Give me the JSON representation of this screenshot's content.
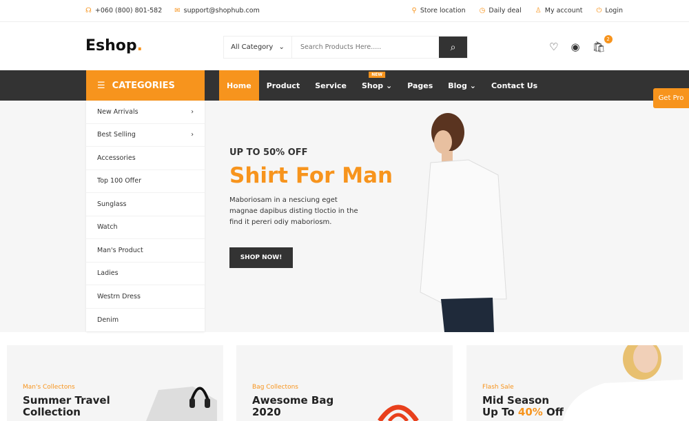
{
  "topbar": {
    "phone": "+060 (800) 801-582",
    "email": "support@shophub.com",
    "store": "Store location",
    "deal": "Daily deal",
    "account": "My account",
    "login": "Login"
  },
  "header": {
    "logo": "Eshop",
    "logo_dot": ".",
    "category": "All Category",
    "search_placeholder": "Search Products Here.....",
    "cart_count": "2"
  },
  "nav": {
    "categories": "CATEGORIES",
    "items": [
      "Home",
      "Product",
      "Service",
      "Shop",
      "Pages",
      "Blog",
      "Contact Us"
    ],
    "new_badge": "NEW",
    "get_pro": "Get Pro"
  },
  "categories": [
    "New Arrivals",
    "Best Selling",
    "Accessories",
    "Top 100 Offer",
    "Sunglass",
    "Watch",
    "Man's Product",
    "Ladies",
    "Westrn Dress",
    "Denim"
  ],
  "hero": {
    "kicker": "UP TO 50% OFF",
    "title": "Shirt For Man",
    "desc": "Maboriosam in a nesciung eget magnae dapibus disting tloctio in the find it pereri odiy maboriosm.",
    "button": "SHOP NOW!"
  },
  "cards": [
    {
      "sub": "Man's Collectons",
      "title1": "Summer Travel",
      "title2": "Collection"
    },
    {
      "sub": "Bag Collectons",
      "title1": "Awesome Bag",
      "title2": "2020"
    },
    {
      "sub": "Flash Sale",
      "title1": "Mid Season",
      "title2_pre": "Up To ",
      "title2_hl": "40%",
      "title2_post": " Off"
    }
  ],
  "colors": {
    "accent": "#F7941D",
    "dark": "#333333"
  }
}
